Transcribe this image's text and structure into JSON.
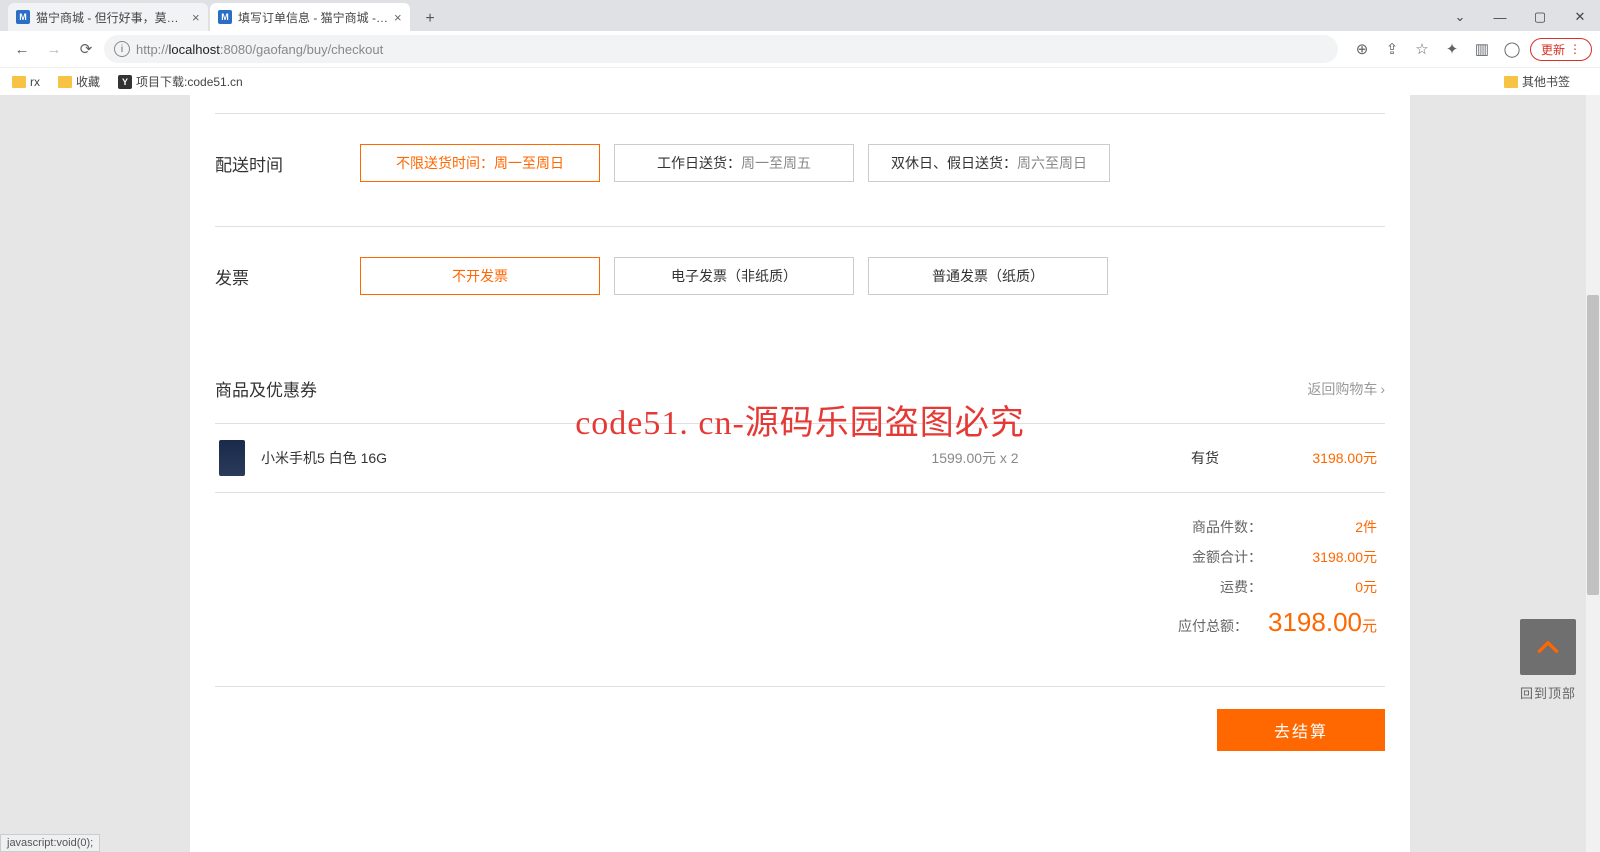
{
  "browser": {
    "tabs": [
      {
        "title": "猫宁商城 - 但行好事，莫问前程",
        "active": false,
        "favicon": "M"
      },
      {
        "title": "填写订单信息 - 猫宁商城 - 但行",
        "active": true,
        "favicon": "M"
      }
    ],
    "url_prefix": "http://",
    "url_host": "localhost",
    "url_port": ":8080",
    "url_path": "/gaofang/buy/checkout",
    "update_label": "更新",
    "bookmarks": [
      {
        "label": "rx",
        "type": "folder"
      },
      {
        "label": "收藏",
        "type": "folder"
      },
      {
        "label": "项目下载:code51.cn",
        "type": "icon"
      }
    ],
    "other_bookmarks": "其他书签",
    "status_bar": "javascript:void(0);"
  },
  "delivery": {
    "label": "配送时间",
    "options": [
      {
        "head": "不限送货时间：",
        "tail": "周一至周日",
        "selected": true
      },
      {
        "head": "工作日送货：",
        "tail": "周一至周五",
        "selected": false
      },
      {
        "head": "双休日、假日送货：",
        "tail": "周六至周日",
        "selected": false
      }
    ]
  },
  "invoice": {
    "label": "发票",
    "options": [
      {
        "text": "不开发票",
        "selected": true
      },
      {
        "text": "电子发票（非纸质）",
        "selected": false
      },
      {
        "text": "普通发票（纸质）",
        "selected": false
      }
    ]
  },
  "goods": {
    "title": "商品及优惠券",
    "back_to_cart": "返回购物车",
    "items": [
      {
        "name": "小米手机5  白色 16G",
        "unit_price": "1599.00元 x 2",
        "stock": "有货",
        "subtotal": "3198.00元"
      }
    ]
  },
  "summary": {
    "rows": [
      {
        "label": "商品件数：",
        "value": "2件"
      },
      {
        "label": "金额合计：",
        "value": "3198.00元"
      },
      {
        "label": "运费：",
        "value": "0元"
      }
    ],
    "total_label": "应付总额：",
    "total_value": "3198.00",
    "total_unit": "元"
  },
  "checkout_button": "去结算",
  "backtop": {
    "label": "回到顶部"
  },
  "watermark": "code51. cn-源码乐园盗图必究"
}
